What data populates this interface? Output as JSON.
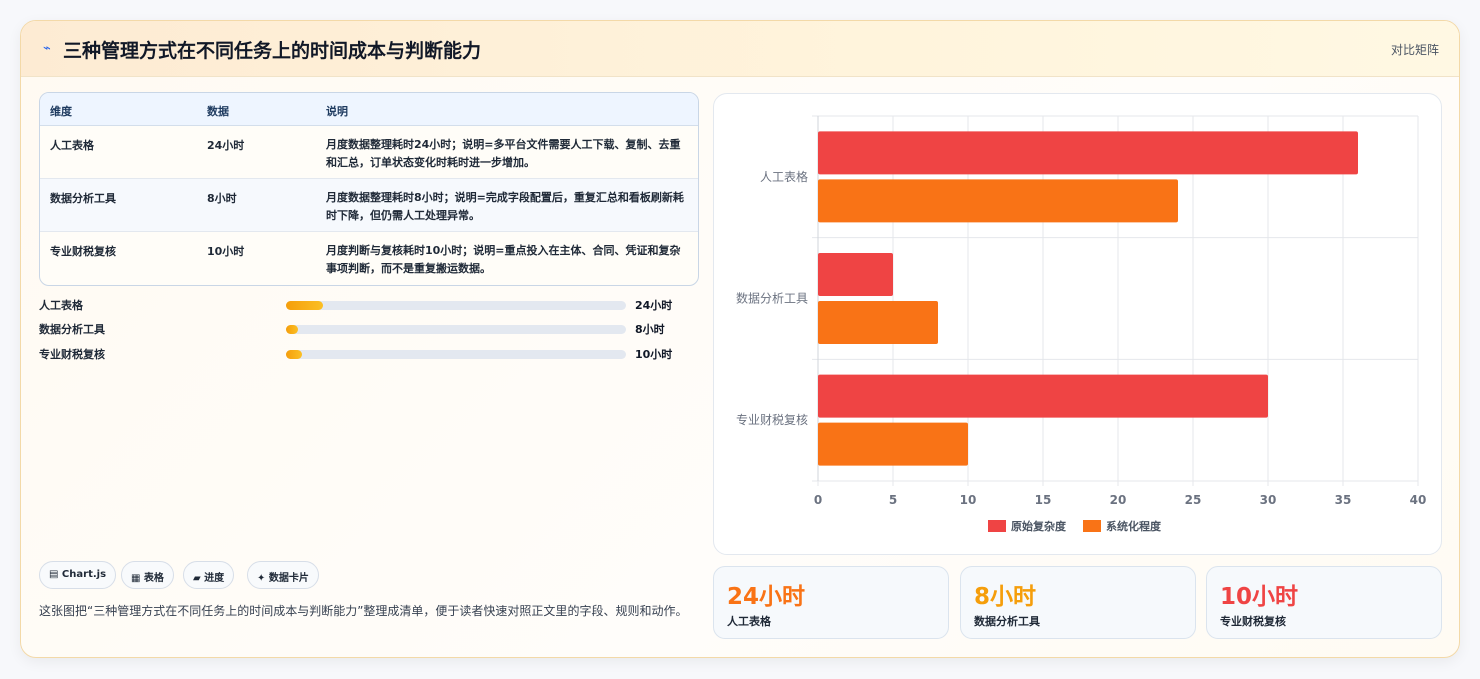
{
  "header": {
    "title": "三种管理方式在不同任务上的时间成本与判断能力",
    "badge": "对比矩阵"
  },
  "table": {
    "headers": [
      "维度",
      "数据",
      "说明"
    ],
    "rows": [
      {
        "dim": "人工表格",
        "data": "24小时",
        "note": "月度数据整理耗时24小时；说明=多平台文件需要人工下载、复制、去重和汇总，订单状态变化时耗时进一步增加。"
      },
      {
        "dim": "数据分析工具",
        "data": "8小时",
        "note": "月度数据整理耗时8小时；说明=完成字段配置后，重复汇总和看板刷新耗时下降，但仍需人工处理异常。"
      },
      {
        "dim": "专业财税复核",
        "data": "10小时",
        "note": "月度判断与复核耗时10小时；说明=重点投入在主体、合同、凭证和复杂事项判断，而不是重复搬运数据。"
      }
    ]
  },
  "progress": [
    {
      "label": "人工表格",
      "value": "24小时",
      "fraction": 0.11
    },
    {
      "label": "数据分析工具",
      "value": "8小时",
      "fraction": 0.035
    },
    {
      "label": "专业财税复核",
      "value": "10小时",
      "fraction": 0.047
    }
  ],
  "tags": [
    "▤ Chart.js",
    "▦ 表格",
    "▰ 进度",
    "✦ 数据卡片"
  ],
  "description": "这张图把“三种管理方式在不同任务上的时间成本与判断能力”整理成清单，便于读者快速对照正文里的字段、规则和动作。",
  "stats": [
    {
      "value": "24小时",
      "label": "人工表格",
      "color": "#f97316"
    },
    {
      "value": "8小时",
      "label": "数据分析工具",
      "color": "#f59e0b"
    },
    {
      "value": "10小时",
      "label": "专业财税复核",
      "color": "#ef4444"
    }
  ],
  "chart_data": {
    "type": "bar",
    "orientation": "horizontal",
    "categories": [
      "人工表格",
      "数据分析工具",
      "专业财税复核"
    ],
    "series": [
      {
        "name": "原始复杂度",
        "color": "#ef4444",
        "values": [
          36,
          5,
          30
        ]
      },
      {
        "name": "系统化程度",
        "color": "#f97316",
        "values": [
          24,
          8,
          10
        ]
      }
    ],
    "xlim": [
      0,
      40
    ],
    "xticks": [
      0,
      5,
      10,
      15,
      20,
      25,
      30,
      35,
      40
    ],
    "grid": true,
    "legend": "bottom"
  }
}
